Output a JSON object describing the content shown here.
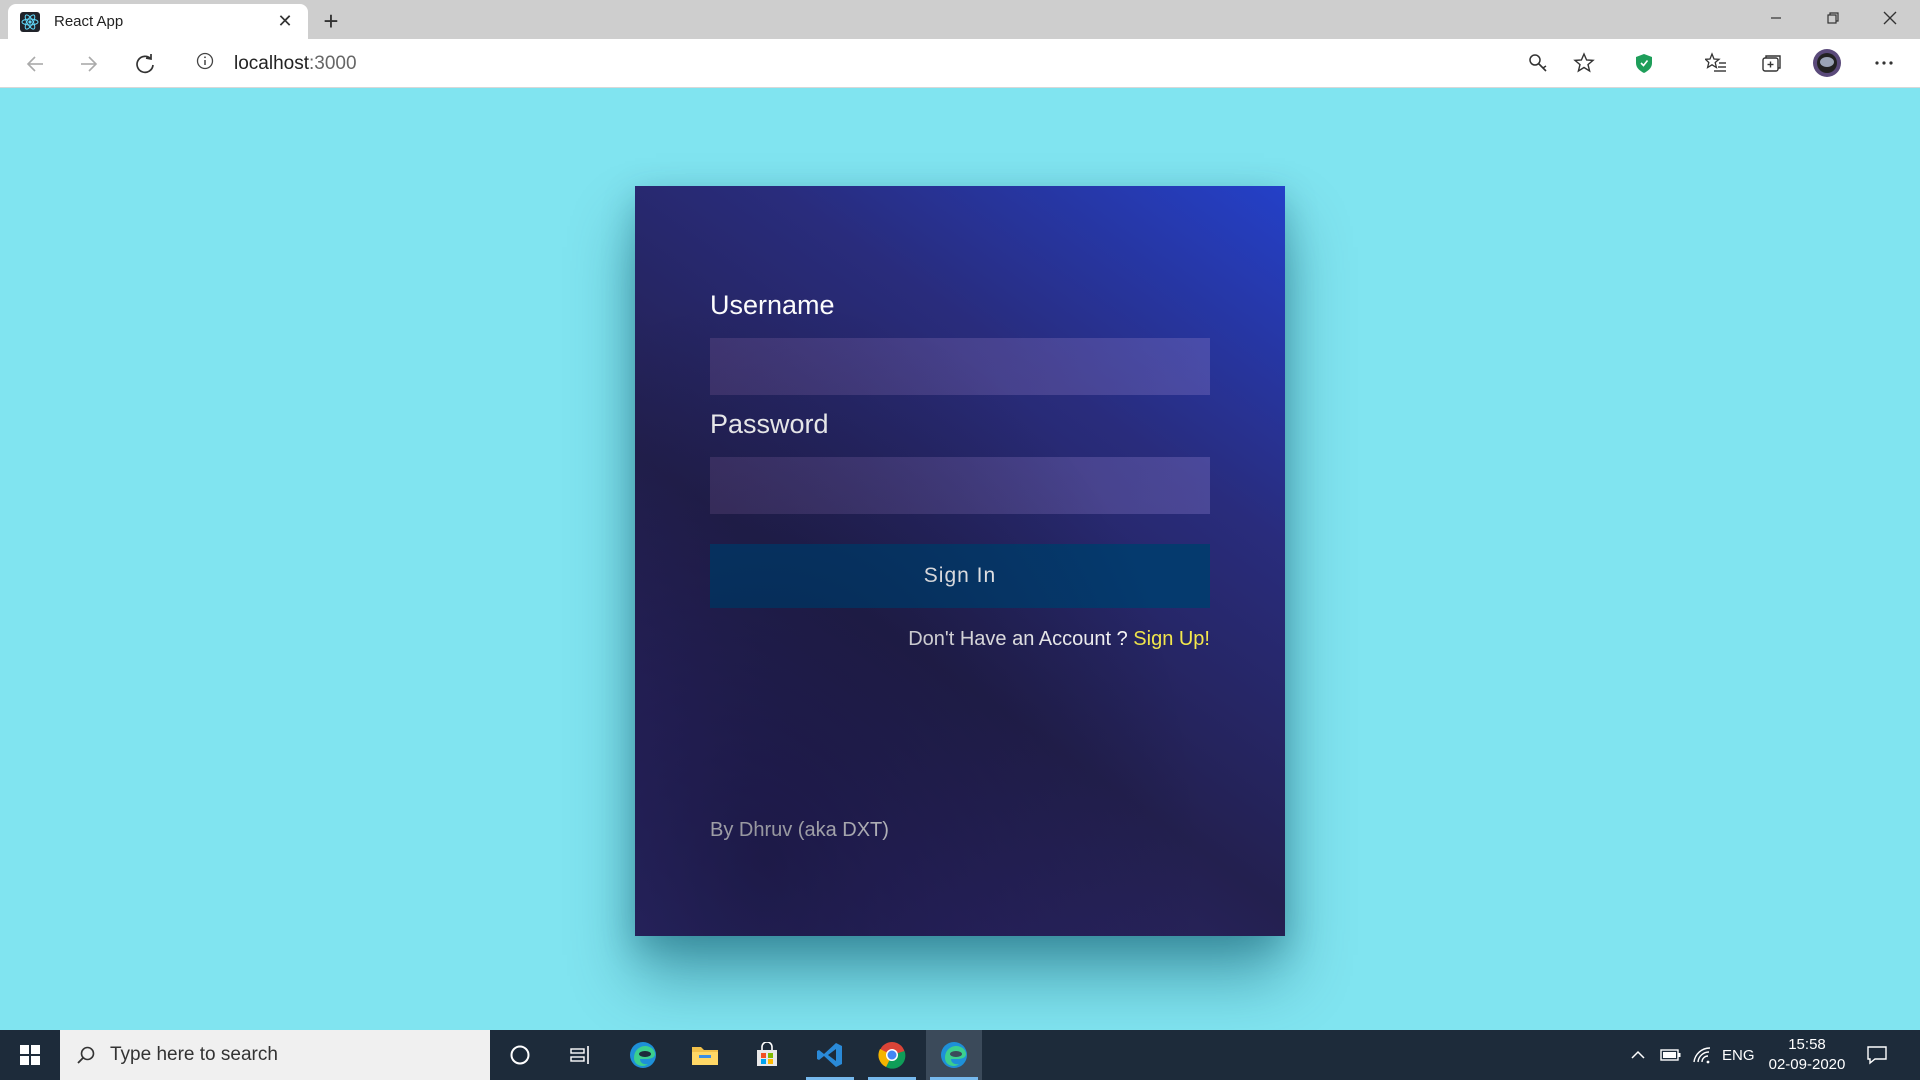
{
  "browser": {
    "tab_title": "React App",
    "address_host": "localhost",
    "address_port": ":3000"
  },
  "login": {
    "username_label": "Username",
    "username_value": "",
    "password_label": "Password",
    "password_value": "",
    "signin_label": "Sign In",
    "no_account_text": "Don't Have an Account ? ",
    "signup_link": "Sign Up!",
    "byline": "By Dhruv (aka DXT)"
  },
  "taskbar": {
    "search_placeholder": "Type here to search",
    "language": "ENG",
    "time": "15:58",
    "date": "02-09-2020"
  },
  "colors": {
    "page_background": "#80e4f0",
    "signin_button": "#053a6e",
    "signup_link": "#f4e84c"
  }
}
